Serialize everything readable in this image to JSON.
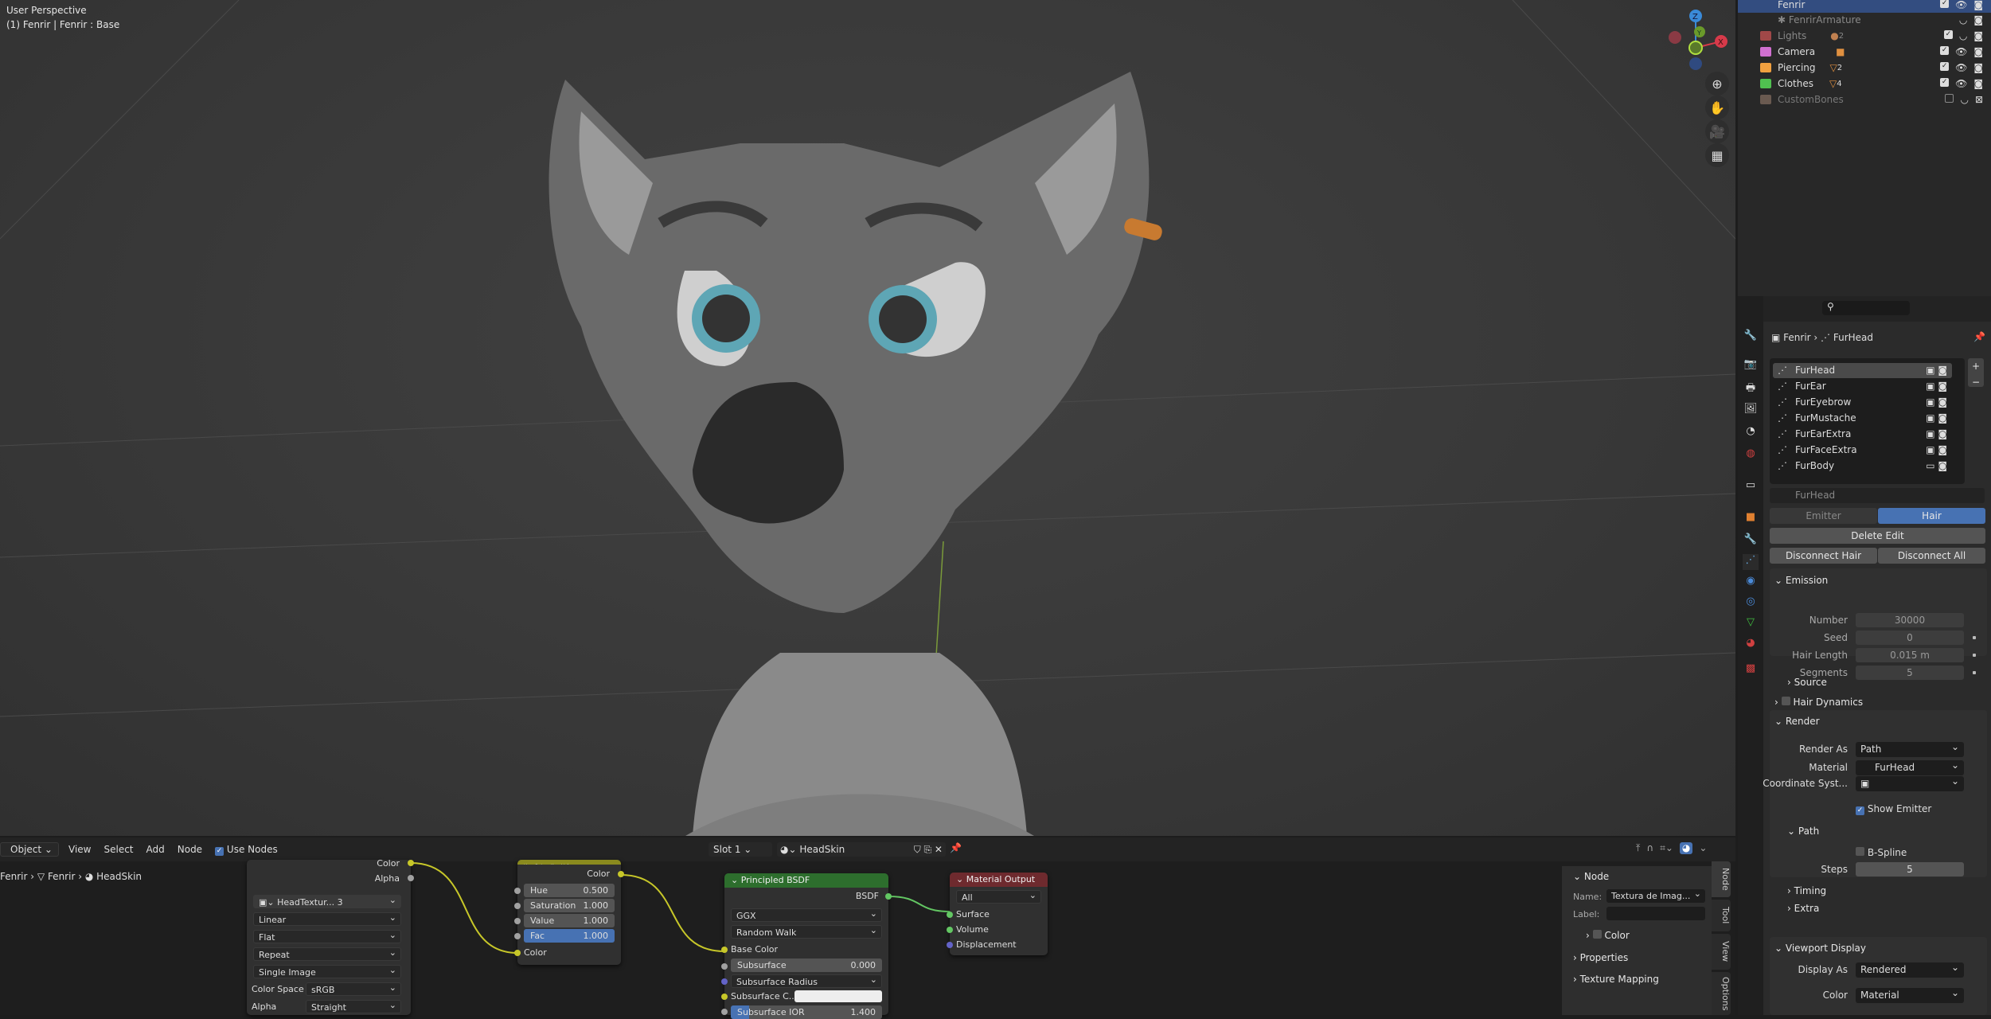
{
  "viewport": {
    "mode": "User Perspective",
    "context": "(1) Fenrir | Fenrir : Base",
    "axes": [
      "X",
      "Y",
      "Z"
    ],
    "tools": [
      "zoom-icon",
      "hand-icon",
      "camera-icon",
      "grid-icon"
    ]
  },
  "outliner": {
    "items": [
      {
        "name": "Fenrir",
        "color": "#4a9fd8",
        "selected": true
      },
      {
        "name": "FenrirArmature",
        "color": "#b07a50",
        "dim": true
      },
      {
        "name": "Lights",
        "color": "#a04848",
        "dim": true,
        "count": "2"
      },
      {
        "name": "Camera",
        "color": "#d070d0"
      },
      {
        "name": "Piercing",
        "color": "#f0a040",
        "count": "2"
      },
      {
        "name": "Clothes",
        "color": "#50c050",
        "count": "4"
      },
      {
        "name": "CustomBones",
        "color": "#6a5a50",
        "dim": true
      }
    ]
  },
  "properties": {
    "breadcrumb": [
      "Fenrir",
      "FurHead"
    ],
    "particle_systems": [
      "FurHead",
      "FurEar",
      "FurEyebrow",
      "FurMustache",
      "FurEarExtra",
      "FurFaceExtra",
      "FurBody"
    ],
    "settings_name": "FurHead",
    "type_tabs": [
      "Emitter",
      "Hair"
    ],
    "delete_edit": "Delete Edit",
    "disconnect_hair": "Disconnect Hair",
    "disconnect_all": "Disconnect All",
    "emission": {
      "title": "Emission",
      "fields": [
        {
          "label": "Number",
          "value": "30000"
        },
        {
          "label": "Seed",
          "value": "0"
        },
        {
          "label": "Hair Length",
          "value": "0.015 m"
        },
        {
          "label": "Segments",
          "value": "5"
        }
      ],
      "source": "Source"
    },
    "hair_dynamics": "Hair Dynamics",
    "render": {
      "title": "Render",
      "render_as_label": "Render As",
      "render_as": "Path",
      "material_label": "Material",
      "material": "FurHead",
      "coord_label": "Coordinate Syst...",
      "show_emitter": "Show Emitter",
      "path": "Path",
      "bspline": "B-Spline",
      "steps_label": "Steps",
      "steps": "5",
      "timing": "Timing",
      "extra": "Extra"
    },
    "viewport_display": {
      "title": "Viewport Display",
      "display_as_label": "Display As",
      "display_as": "Rendered",
      "color_label": "Color",
      "color": "Material"
    }
  },
  "node_editor": {
    "header": {
      "mode": "Object",
      "menus": [
        "View",
        "Select",
        "Add",
        "Node"
      ],
      "use_nodes": "Use Nodes",
      "slot": "Slot 1",
      "material": "HeadSkin"
    },
    "breadcrumb": [
      "Fenrir",
      "Fenrir",
      "HeadSkin"
    ],
    "image_node": {
      "out_color": "Color",
      "out_alpha": "Alpha",
      "image": "HeadTextur...",
      "users": "3",
      "interp": "Linear",
      "proj": "Flat",
      "ext": "Repeat",
      "source": "Single Image",
      "cs_label": "Color Space",
      "cs": "sRGB",
      "alpha_label": "Alpha",
      "alpha": "Straight"
    },
    "hsv_node": {
      "title": "Hue Saturation Value",
      "out": "Color",
      "fields": [
        {
          "label": "Hue",
          "value": "0.500"
        },
        {
          "label": "Saturation",
          "value": "1.000"
        },
        {
          "label": "Value",
          "value": "1.000"
        },
        {
          "label": "Fac",
          "value": "1.000"
        }
      ],
      "in": "Color"
    },
    "bsdf_node": {
      "title": "Principled BSDF",
      "out": "BSDF",
      "dist": "GGX",
      "sss": "Random Walk",
      "base_color": "Base Color",
      "subsurface": "Subsurface",
      "subsurface_val": "0.000",
      "radius": "Subsurface Radius",
      "sss_color": "Subsurface C...",
      "ior": "Subsurface IOR",
      "ior_val": "1.400"
    },
    "output_node": {
      "title": "Material Output",
      "target": "All",
      "inputs": [
        "Surface",
        "Volume",
        "Displacement"
      ]
    },
    "sidebar": {
      "section": "Node",
      "name_label": "Name:",
      "name": "Textura de Imag...",
      "label_label": "Label:",
      "color": "Color",
      "properties": "Properties",
      "texture_mapping": "Texture Mapping",
      "tabs": [
        "Node",
        "Tool",
        "View",
        "Options"
      ]
    }
  }
}
